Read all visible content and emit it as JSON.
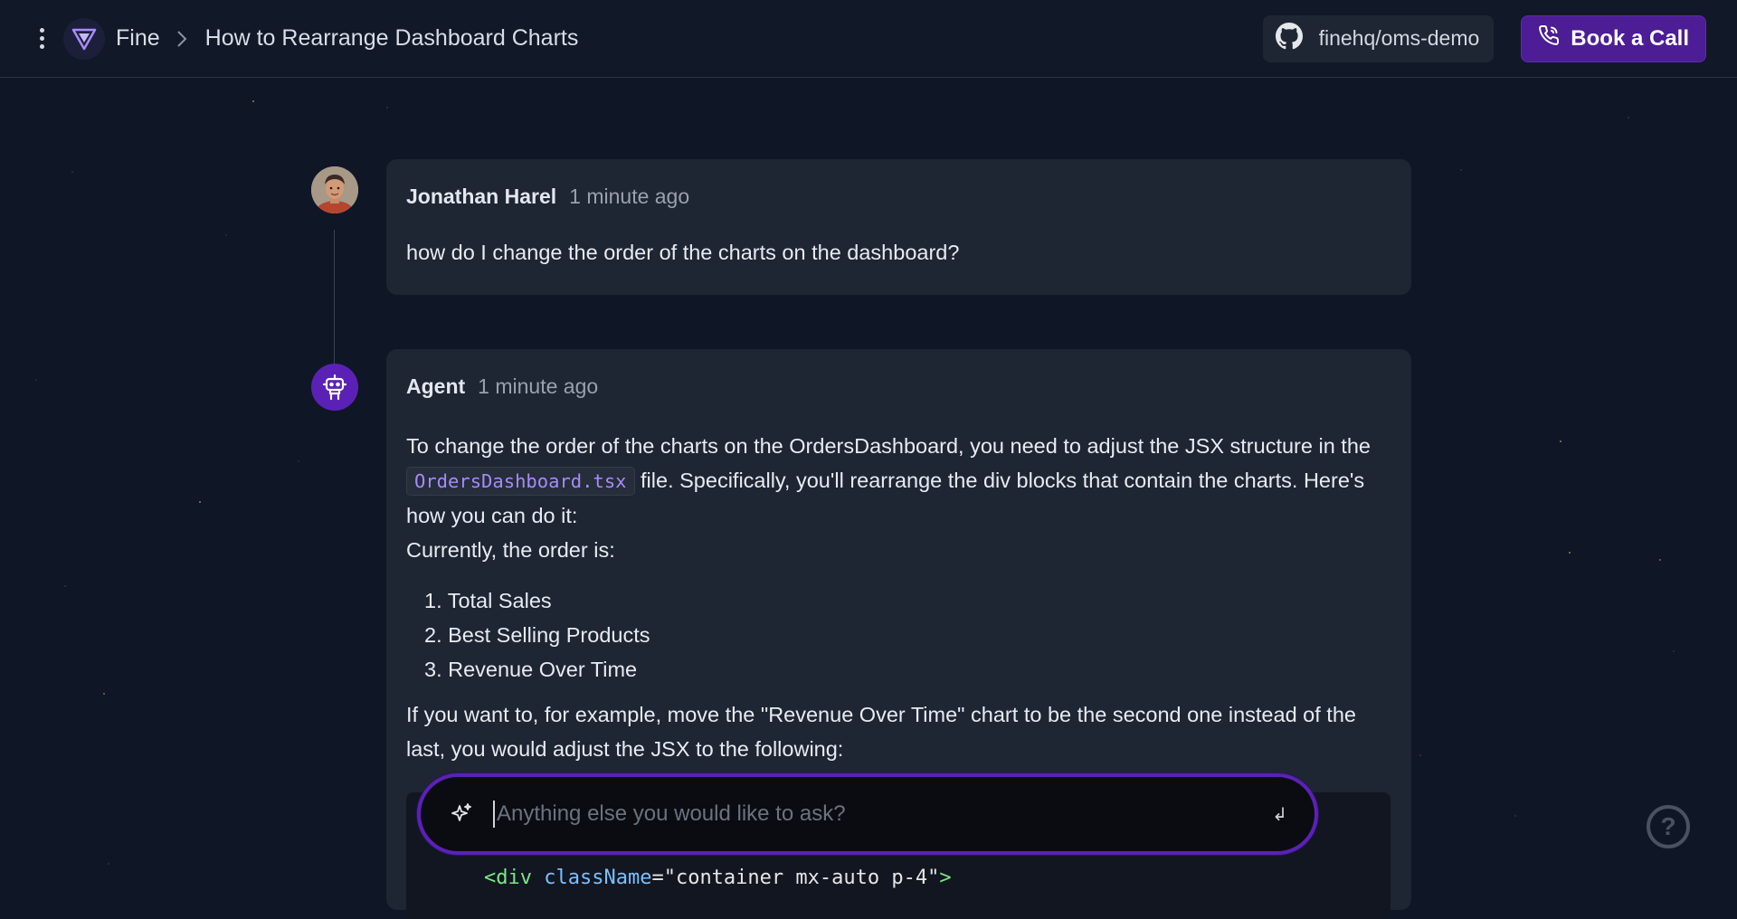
{
  "header": {
    "brand": "Fine",
    "breadcrumb_sep": ">",
    "title": "How to Rearrange Dashboard Charts",
    "repo": "finehq/oms-demo",
    "book_call": "Book a Call"
  },
  "messages": {
    "user": {
      "author": "Jonathan Harel",
      "time": "1 minute ago",
      "text": "how do I change the order of the charts on the dashboard?"
    },
    "agent": {
      "author": "Agent",
      "time": "1 minute ago",
      "p1_before": "To change the order of the charts on the OrdersDashboard, you need to adjust the JSX structure in the ",
      "p1_code": "OrdersDashboard.tsx",
      "p1_after": " file. Specifically, you'll rearrange the div blocks that contain the charts. Here's how you can do it:",
      "p2": "Currently, the order is:",
      "list": [
        "1. Total Sales",
        "2. Best Selling Products",
        "3. Revenue Over Time"
      ],
      "p3": "If you want to, for example, move the \"Revenue Over Time\" chart to be the second one instead of the last, you would adjust the JSX to the following:",
      "code": {
        "open": "<div",
        "attr": "className",
        "eq": "=",
        "value": "\"container mx-auto p-4\"",
        "close": ">"
      }
    }
  },
  "prompt": {
    "placeholder": "Anything else you would like to ask?",
    "enter_symbol": "↲"
  },
  "help": "?",
  "colors": {
    "accent": "#5b21b6",
    "button": "#4c1d95",
    "background": "#0f1626",
    "card": "#1e2533"
  },
  "icons": {
    "menu": "kebab-menu-icon",
    "logo": "fine-logo-icon",
    "repo": "github-icon",
    "call": "phone-icon",
    "agent": "robot-icon",
    "prompt": "sparkle-icon",
    "help": "help-icon"
  }
}
